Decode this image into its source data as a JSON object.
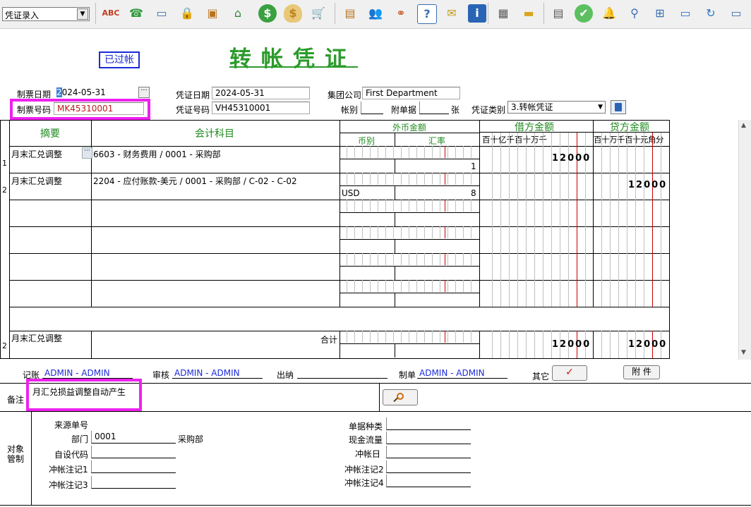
{
  "toolbar": {
    "mode": "凭证录入",
    "buttons": [
      {
        "icon": "spellcheck-icon",
        "glyph": "ABC",
        "color": "#c43c1f"
      },
      {
        "icon": "phone-icon",
        "glyph": "☎",
        "color": "#2e9a3b"
      },
      {
        "icon": "monitor-icon",
        "glyph": "▭",
        "color": "#3a6fb0"
      },
      {
        "icon": "lock-icon",
        "glyph": "🔒",
        "color": "#c49a1a"
      },
      {
        "icon": "briefcase-icon",
        "glyph": "▣",
        "color": "#b8731e"
      },
      {
        "icon": "house-icon",
        "glyph": "⌂",
        "color": "#2f8a3a"
      },
      {
        "icon": "dollar-coin-icon",
        "glyph": "$",
        "color": "#2f8a3a"
      },
      {
        "icon": "money-bag-icon",
        "glyph": "$",
        "color": "#b8841e"
      },
      {
        "icon": "cart-icon",
        "glyph": "🛒",
        "color": "#3a6fb0"
      },
      {
        "icon": "clipboard-icon",
        "glyph": "▤",
        "color": "#b8731e"
      },
      {
        "icon": "users-icon",
        "glyph": "👥",
        "color": "#5a6ab0"
      },
      {
        "icon": "link-icon",
        "glyph": "⚭",
        "color": "#c4571e"
      },
      {
        "icon": "help-document-icon",
        "glyph": "?",
        "color": "#3a6fb0"
      },
      {
        "icon": "mail-icon",
        "glyph": "✉",
        "color": "#c49a1a"
      },
      {
        "icon": "info-icon",
        "glyph": "i",
        "color": "#ffffff"
      },
      {
        "icon": "calculator-icon",
        "glyph": "▦",
        "color": "#5a5a5a"
      },
      {
        "icon": "folder-icon",
        "glyph": "▬",
        "color": "#d9a520"
      },
      {
        "icon": "documents-icon",
        "glyph": "▤",
        "color": "#5a5a5a"
      },
      {
        "icon": "check-circle-icon",
        "glyph": "✔",
        "color": "#2e9a3b"
      },
      {
        "icon": "bell-icon",
        "glyph": "🔔",
        "color": "#d9a520"
      },
      {
        "icon": "magnifier-icon",
        "glyph": "⚲",
        "color": "#3a6fb0"
      },
      {
        "icon": "org-chart-icon",
        "glyph": "⊞",
        "color": "#3a6fb0"
      },
      {
        "icon": "display-icon",
        "glyph": "▭",
        "color": "#2a78c8"
      },
      {
        "icon": "refresh-icon",
        "glyph": "↻",
        "color": "#2a78c8"
      },
      {
        "icon": "window-icon",
        "glyph": "▭",
        "color": "#3a6fb0"
      }
    ]
  },
  "header": {
    "status_stamp": "已过帐",
    "title": "转帐凭证",
    "make_date_label": "制票日期",
    "make_date": "2024-05-31",
    "make_no_label": "制票号码",
    "make_no": "MK45310001",
    "voucher_date_label": "凭证日期",
    "voucher_date": "2024-05-31",
    "voucher_no_label": "凭证号码",
    "voucher_no": "VH45310001",
    "group_label": "集团公司",
    "group_value": "First Department",
    "account_book_label": "帐别",
    "attachments_label": "附单据",
    "attachments_unit": "张",
    "voucher_type_label": "凭证类别",
    "voucher_type": "3.转帐凭证",
    "ellipsis": "···",
    "dropdown_arrow": "▼"
  },
  "table": {
    "col_summary": "摘要",
    "col_account": "会计科目",
    "col_foreign": "外币金额",
    "col_currency": "币别",
    "col_rate": "汇率",
    "col_debit": "借方金额",
    "col_credit": "贷方金额",
    "debit_digits_header": "百十亿千百十万千",
    "credit_digits_header": "百十万千百十元角分",
    "rows": [
      {
        "no": "1",
        "summary": "月末汇兑调整",
        "account": "6603 - 财务费用 / 0001 - 采购部",
        "currency": "",
        "rate": "1",
        "debit": "12000",
        "credit": ""
      },
      {
        "no": "2",
        "summary": "月末汇兑调整",
        "account": "2204 - 应付账款-美元 / 0001 - 采购部 / C-02 - C-02",
        "currency": "USD",
        "rate": "8",
        "debit": "",
        "credit": "12000"
      }
    ],
    "total_label": "合计",
    "total_count": "2",
    "total_summary": "月末汇兑调整",
    "total_debit": "12000",
    "total_credit": "12000"
  },
  "footer": {
    "post_label": "记账",
    "post_value": "ADMIN - ADMIN",
    "audit_label": "审核",
    "audit_value": "ADMIN - ADMIN",
    "cashier_label": "出纳",
    "maker_label": "制单",
    "maker_value": "ADMIN - ADMIN",
    "other_label": "其它",
    "other_check": "✓",
    "attach_button": "附 件",
    "remark_label": "备注",
    "remark_value": "月汇兑损益调整自动产生",
    "object_mgmt_line1": "对象",
    "object_mgmt_line2": "管制",
    "source_no_label": "来源单号",
    "dept_label": "部门",
    "dept_code": "0001",
    "dept_name": "采购部",
    "custom_code_label": "自设代码",
    "offset_note1_label": "冲帐注记1",
    "offset_note3_label": "冲帐注记3",
    "doc_type_label": "单据种类",
    "cash_flow_label": "现金流量",
    "offset_date_label": "冲帐日",
    "offset_note2_label": "冲帐注记2",
    "offset_note4_label": "冲帐注记4"
  },
  "colors": {
    "accent_green": "#2b9b2b",
    "stamp_blue": "#1b2ad8",
    "highlight_magenta": "#ee22ee",
    "divider_red": "#cc0000"
  }
}
